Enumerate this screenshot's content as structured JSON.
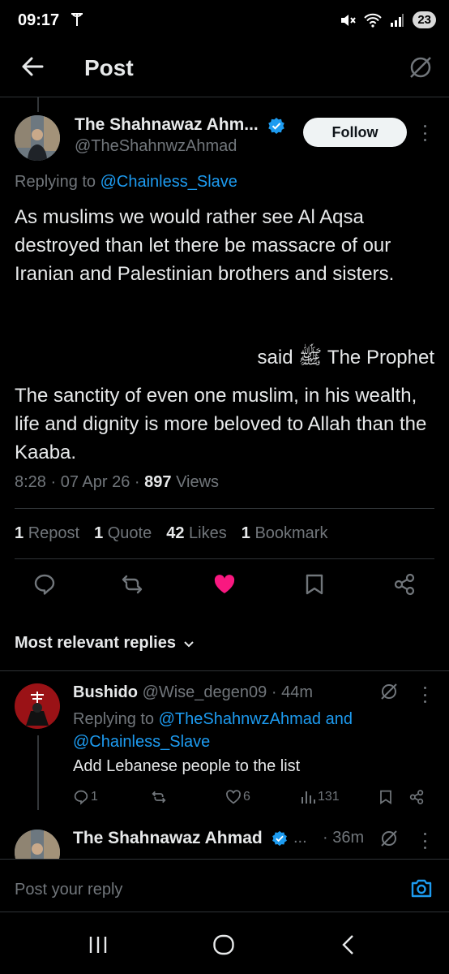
{
  "status_bar": {
    "time": "09:17",
    "battery": "23"
  },
  "header": {
    "title": "Post"
  },
  "post": {
    "author_name": "The Shahnawaz Ahm...",
    "author_handle": "@TheShahnwzAhmad",
    "follow_label": "Follow",
    "replying_prefix": "Replying to",
    "replying_to": "@Chainless_Slave",
    "body_paragraph_1": "As muslims we would rather see Al Aqsa destroyed than let there be massacre of our Iranian and Palestinian brothers and sisters.",
    "quote_line": "said ﷺ The Prophet",
    "body_paragraph_2": "The sanctity of even one muslim, in his wealth, life and dignity is more beloved to Allah than the Kaaba.",
    "time": "8:28",
    "date": "07 Apr 26",
    "views_count": "897",
    "views_label": "Views",
    "stats": {
      "reposts_count": "1",
      "reposts_label": "Repost",
      "quotes_count": "1",
      "quotes_label": "Quote",
      "likes_count": "42",
      "likes_label": "Likes",
      "bookmarks_count": "1",
      "bookmarks_label": "Bookmark"
    }
  },
  "replies_section": {
    "sort_label": "Most relevant replies"
  },
  "reply_1": {
    "name": "Bushido",
    "handle": "@Wise_degen09",
    "age": "44m",
    "replying_prefix": "Replying to",
    "replying_to_1": "@TheShahnwzAhmad",
    "replying_and": "and",
    "replying_to_2": "@Chainless_Slave",
    "text": "Add Lebanese people to the list",
    "reply_count": "1",
    "like_count": "6",
    "view_count": "131"
  },
  "reply_2": {
    "name": "The Shahnawaz Ahmad",
    "ellipsis": "...",
    "age": "36m"
  },
  "compose": {
    "placeholder": "Post your reply"
  },
  "colors": {
    "accent": "#1d9bf0",
    "like": "#f91880",
    "muted": "#71767b"
  }
}
